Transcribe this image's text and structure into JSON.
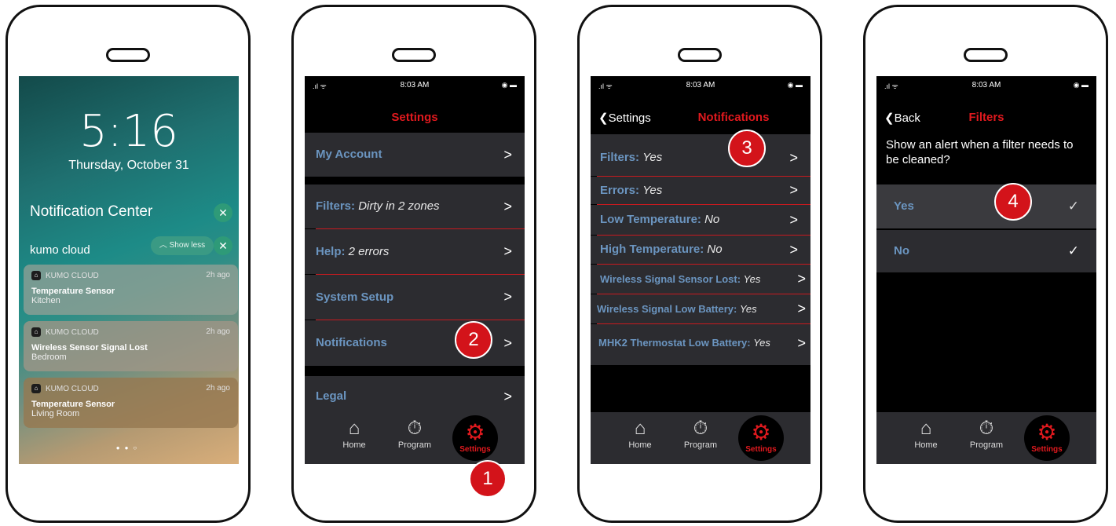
{
  "lock": {
    "time": "5:16",
    "date": "Thursday, October 31",
    "nc_title": "Notification Center",
    "app_group": "kumo cloud",
    "show_less": "Show less",
    "notifications": [
      {
        "app": "KUMO CLOUD",
        "ago": "2h ago",
        "title": "Temperature Sensor",
        "body": "Kitchen"
      },
      {
        "app": "KUMO CLOUD",
        "ago": "2h ago",
        "title": "Wireless Sensor Signal Lost",
        "body": "Bedroom"
      },
      {
        "app": "KUMO CLOUD",
        "ago": "2h ago",
        "title": "Temperature Sensor",
        "body": "Living Room"
      }
    ]
  },
  "status_time": "8:03 AM",
  "tabs": {
    "home": "Home",
    "program": "Program",
    "settings": "Settings"
  },
  "settings": {
    "title": "Settings",
    "rows": [
      {
        "label": "My Account",
        "value": ""
      },
      {
        "label": "Filters:",
        "value": "Dirty in 2 zones"
      },
      {
        "label": "Help:",
        "value": "2 errors"
      },
      {
        "label": "System Setup",
        "value": ""
      },
      {
        "label": "Notifications",
        "value": ""
      },
      {
        "label": "Legal",
        "value": ""
      }
    ]
  },
  "notifications_screen": {
    "back": "Settings",
    "title": "Notifications",
    "rows": [
      {
        "label": "Filters:",
        "value": "Yes"
      },
      {
        "label": "Errors:",
        "value": "Yes"
      },
      {
        "label": "Low Temperature:",
        "value": "No"
      },
      {
        "label": "High Temperature:",
        "value": "No"
      },
      {
        "label": "Wireless Signal Sensor Lost:",
        "value": "Yes"
      },
      {
        "label": "Wireless Signal Low Battery:",
        "value": "Yes"
      },
      {
        "label": "MHK2 Thermostat Low Battery:",
        "value": "Yes"
      }
    ]
  },
  "filters_screen": {
    "back": "Back",
    "title": "Filters",
    "question": "Show an alert when a filter needs to be cleaned?",
    "options": [
      {
        "label": "Yes"
      },
      {
        "label": "No"
      }
    ]
  },
  "badges": [
    "1",
    "2",
    "3",
    "4"
  ],
  "colors": {
    "accent_red": "#e0191e",
    "row_label_blue": "#6b95c0",
    "row_bg": "#2c2c30",
    "badge_red": "#d3131a"
  }
}
